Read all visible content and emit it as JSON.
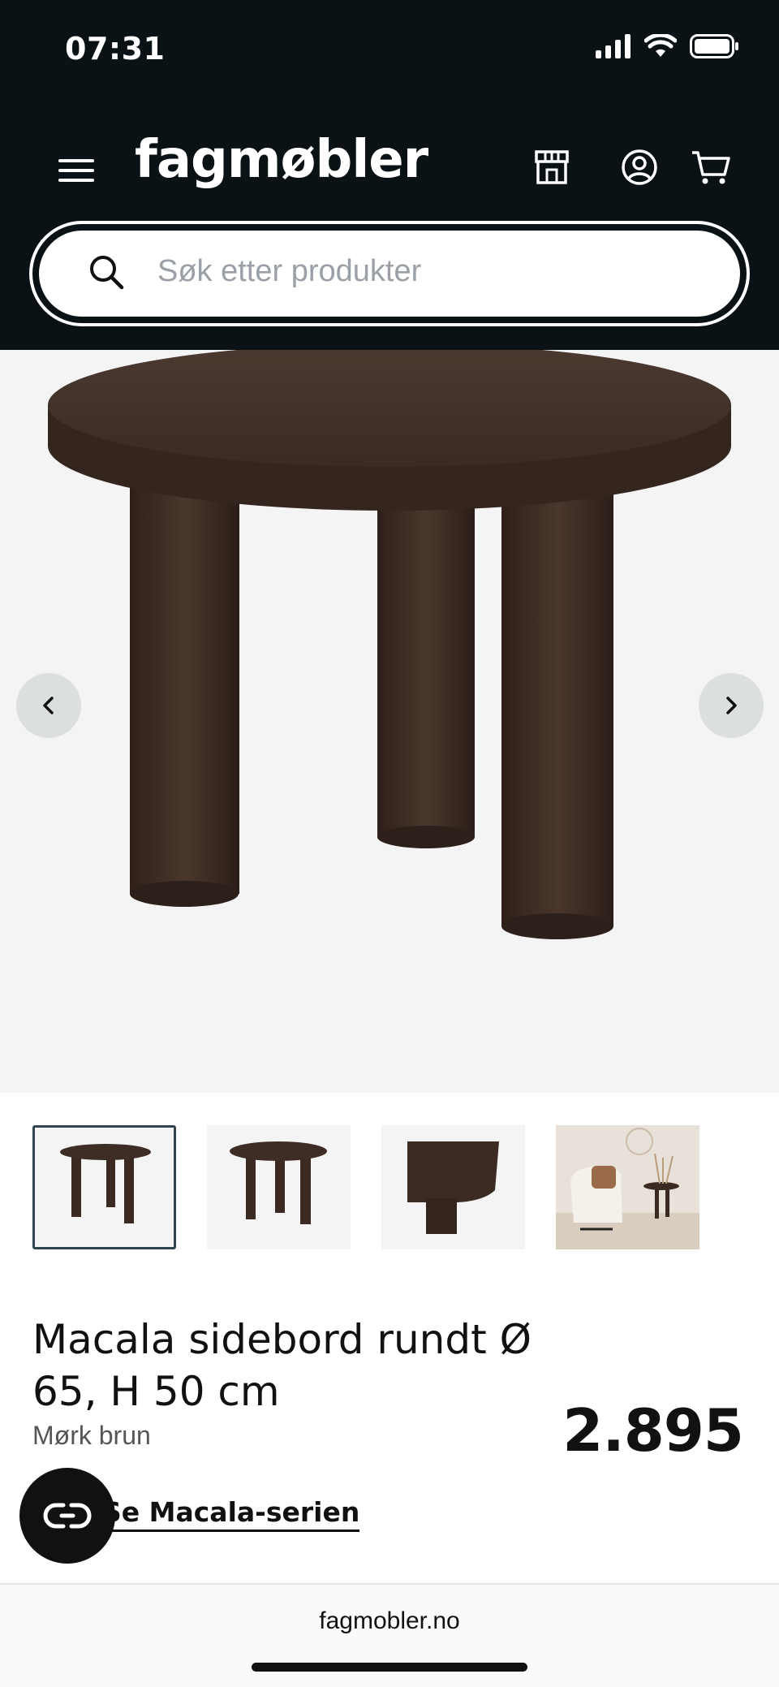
{
  "status_bar": {
    "time": "07:31"
  },
  "header": {
    "logo": "fagmøbler",
    "search": {
      "placeholder": "Søk etter produkter",
      "value": ""
    }
  },
  "icons": {
    "menu": "menu-icon",
    "store": "store-icon",
    "account": "user-icon",
    "cart": "cart-icon",
    "search": "search-icon"
  },
  "gallery": {
    "thumbnails": [
      {
        "name": "table-front",
        "active": true
      },
      {
        "name": "table-angle",
        "active": false
      },
      {
        "name": "table-detail",
        "active": false
      },
      {
        "name": "table-lifestyle",
        "active": false
      }
    ]
  },
  "product": {
    "title": "Macala sidebord rundt Ø 65, H 50 cm",
    "variant": "Mørk brun",
    "price": "2.895",
    "series_link": "Se Macala-serien"
  },
  "browser": {
    "domain": "fagmobler.no"
  },
  "colors": {
    "header_bg": "#0a1216",
    "wood": "#3f2f27",
    "gallery_bg": "#f4f4f4"
  }
}
